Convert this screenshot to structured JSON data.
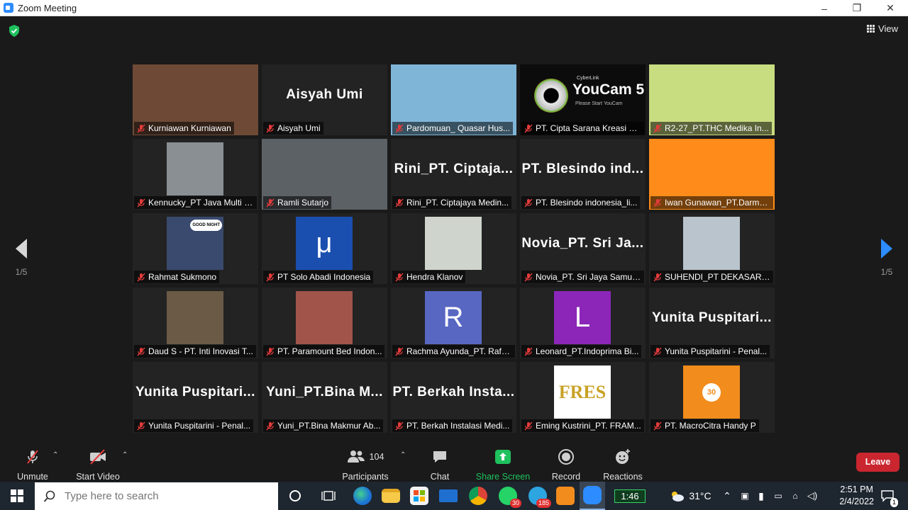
{
  "window": {
    "title": "Zoom Meeting",
    "minimize": "–",
    "restore": "❐",
    "close": "✕"
  },
  "top": {
    "view_label": "View",
    "security_icon": "shield-check-icon"
  },
  "pagination": {
    "left": "1/5",
    "right": "1/5"
  },
  "tiles": [
    {
      "name": "Kurniawan Kurniawan",
      "kind": "video",
      "bg": "#6e4a36"
    },
    {
      "name": "Aisyah Umi",
      "kind": "text",
      "big": "Aisyah Umi"
    },
    {
      "name": "Pardomuan_ Quasar Hus...",
      "kind": "video",
      "bg": "#7fb6d8"
    },
    {
      "name": "PT. Cipta Sarana Kreasi N...",
      "kind": "youcam",
      "logo": "YouCam 5",
      "sub": "Please Start YouCam",
      "brand": "CyberLink"
    },
    {
      "name": "R2-27_PT.THC Medika In...",
      "kind": "video",
      "bg": "#c8dc80"
    },
    {
      "name": "Kennucky_PT Java Multi Neo...",
      "kind": "video-small",
      "bg": "#8a8f94"
    },
    {
      "name": "Ramli Sutarjo",
      "kind": "video",
      "bg": "#5c6166"
    },
    {
      "name": "Rini_PT. Ciptajaya Medin...",
      "kind": "text",
      "big": "Rini_PT. Ciptaja..."
    },
    {
      "name": "PT. Blesindo indonesia_li...",
      "kind": "text",
      "big": "PT. Blesindo ind..."
    },
    {
      "name": "Iwan Gunawan_PT.Darma...",
      "kind": "color",
      "bg": "#ff8c1a",
      "active": true
    },
    {
      "name": "Rahmat Sukmono",
      "kind": "video-small",
      "bg": "#3a4a6e",
      "bubble": "GOOD NIGHT"
    },
    {
      "name": "PT Solo Abadi Indonesia",
      "kind": "letter",
      "bg": "#1a4fb0",
      "letter": "μ"
    },
    {
      "name": "Hendra Klanov",
      "kind": "video-small",
      "bg": "#cfd5cc"
    },
    {
      "name": "Novia_PT. Sri Jaya Samud...",
      "kind": "text",
      "big": "Novia_PT. Sri Ja..."
    },
    {
      "name": "SUHENDI_PT DEKASARI P...",
      "kind": "video-small",
      "bg": "#b9c4cc"
    },
    {
      "name": "Daud S - PT. Inti Inovasi T...",
      "kind": "video-small",
      "bg": "#6a5a46"
    },
    {
      "name": "PT. Paramount Bed Indon...",
      "kind": "video-small",
      "bg": "#a0544a"
    },
    {
      "name": "Rachma Ayunda_PT. Rafa...",
      "kind": "letter",
      "bg": "#5867c2",
      "letter": "R"
    },
    {
      "name": "Leonard_PT.Indoprima Bi...",
      "kind": "letter",
      "bg": "#8b26b8",
      "letter": "L"
    },
    {
      "name": "Yunita Puspitarini - Penal...",
      "kind": "text",
      "big": "Yunita Puspitari..."
    },
    {
      "name": "Yunita Puspitarini - Penal...",
      "kind": "text",
      "big": "Yunita Puspitari..."
    },
    {
      "name": "Yuni_PT.Bina Makmur Ab...",
      "kind": "text",
      "big": "Yuni_PT.Bina M..."
    },
    {
      "name": "PT. Berkah Instalasi Medi...",
      "kind": "text",
      "big": "PT. Berkah Insta..."
    },
    {
      "name": "Eming Kustrini_PT. FRAM...",
      "kind": "logo",
      "bg": "#ffffff",
      "logo": "FRES"
    },
    {
      "name": "PT. MacroCitra Handy P",
      "kind": "logo-orange",
      "bg": "#f28c1c",
      "logo": "30"
    }
  ],
  "toolbar": {
    "unmute": "Unmute",
    "start_video": "Start Video",
    "participants": "Participants",
    "participants_count": "104",
    "chat": "Chat",
    "share_screen": "Share Screen",
    "record": "Record",
    "reactions": "Reactions",
    "leave": "Leave"
  },
  "taskbar": {
    "search_placeholder": "Type here to search",
    "whatsapp_badge": "30",
    "telegram_badge": "185",
    "battery_widget": "1:46",
    "weather": "31°C",
    "time": "2:51 PM",
    "date": "2/4/2022",
    "notifications": "1"
  },
  "colors": {
    "accent_blue": "#2d8cff",
    "share_green": "#1ec15e",
    "leave_red": "#c9262f",
    "active_border": "#e7f36f",
    "mute_red": "#e33b3b"
  }
}
